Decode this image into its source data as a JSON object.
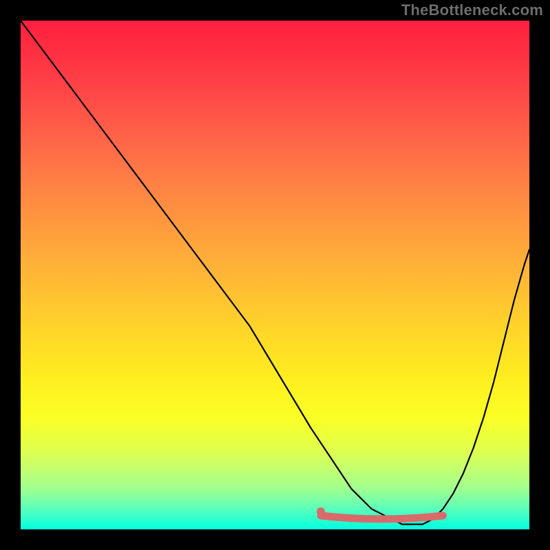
{
  "watermark": "TheBottleneck.com",
  "colors": {
    "curve": "#000000",
    "highlight": "#d96a6a",
    "background_top": "#ff1f3f",
    "background_bottom": "#00ffe0"
  },
  "chart_data": {
    "type": "line",
    "title": "",
    "xlabel": "",
    "ylabel": "",
    "xlim": [
      0,
      100
    ],
    "ylim": [
      0,
      100
    ],
    "series": [
      {
        "name": "bottleneck-curve",
        "x": [
          0,
          3,
          6,
          9,
          12,
          15,
          18,
          21,
          24,
          27,
          30,
          33,
          36,
          39,
          42,
          45,
          48,
          51,
          54,
          57,
          59,
          61,
          63,
          65,
          67,
          69,
          71,
          73,
          75,
          77,
          79,
          81,
          83,
          85,
          87,
          89,
          91,
          93,
          95,
          97,
          99,
          100
        ],
        "values": [
          100,
          96,
          92,
          88,
          84,
          80,
          76,
          72,
          68,
          64,
          60,
          56,
          52,
          48,
          44,
          40,
          35,
          30,
          25,
          20,
          17,
          14,
          11,
          8,
          6,
          4,
          3,
          2,
          1,
          1,
          1,
          2,
          4,
          7,
          11,
          16,
          22,
          29,
          37,
          45,
          52,
          55
        ]
      }
    ],
    "annotations": [
      {
        "name": "optimal-range-highlight",
        "x_range": [
          59,
          83
        ],
        "value": 2,
        "description": "flattened near-minimum segment drawn in salmon"
      }
    ]
  }
}
